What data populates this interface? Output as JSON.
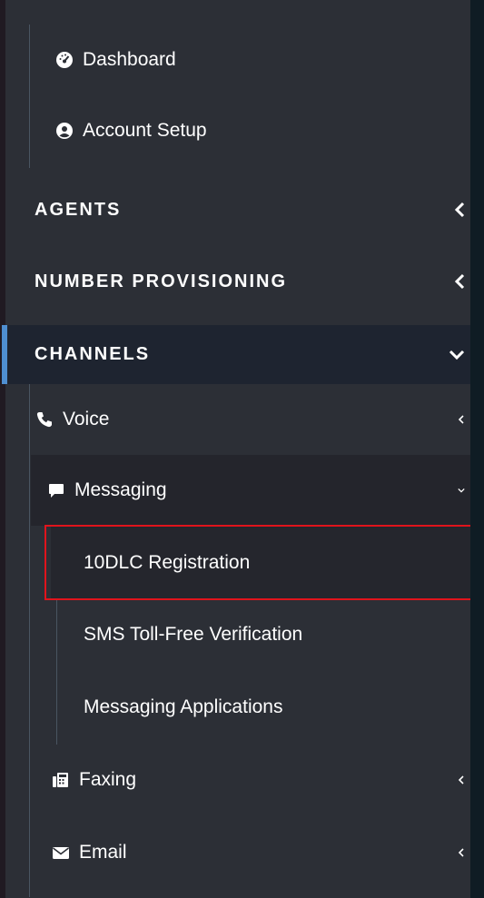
{
  "nav": {
    "top_items": [
      {
        "label": "Dashboard",
        "icon": "dashboard-icon"
      },
      {
        "label": "Account Setup",
        "icon": "user-circle-icon"
      }
    ],
    "sections": [
      {
        "label": "AGENTS",
        "state": "collapsed"
      },
      {
        "label": "NUMBER PROVISIONING",
        "state": "collapsed"
      },
      {
        "label": "CHANNELS",
        "state": "expanded"
      }
    ],
    "channels": [
      {
        "label": "Voice",
        "icon": "phone-icon",
        "state": "collapsed"
      },
      {
        "label": "Messaging",
        "icon": "chat-icon",
        "state": "expanded"
      },
      {
        "label": "Faxing",
        "icon": "fax-icon",
        "state": "collapsed"
      },
      {
        "label": "Email",
        "icon": "envelope-icon",
        "state": "collapsed"
      }
    ],
    "messaging_items": [
      {
        "label": "10DLC Registration",
        "active": true
      },
      {
        "label": "SMS Toll-Free Verification",
        "active": false
      },
      {
        "label": "Messaging Applications",
        "active": false
      }
    ]
  },
  "colors": {
    "sidebar_bg": "#2c2f36",
    "active_section_bg": "#1e2430",
    "active_indicator": "#4f8fd1",
    "highlight_border": "#e0141c",
    "text": "#ffffff"
  }
}
